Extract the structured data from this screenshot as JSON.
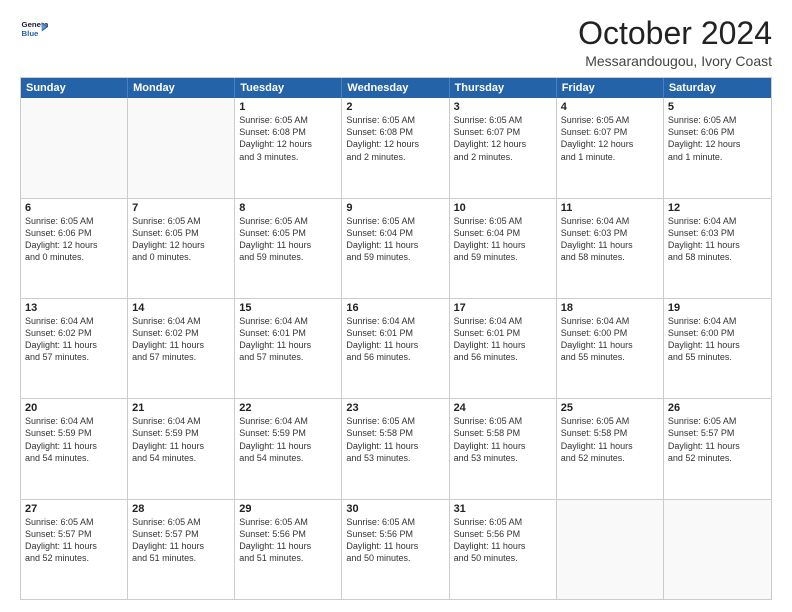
{
  "logo": {
    "line1": "General",
    "line2": "Blue"
  },
  "title": "October 2024",
  "location": "Messarandougou, Ivory Coast",
  "header": {
    "days": [
      "Sunday",
      "Monday",
      "Tuesday",
      "Wednesday",
      "Thursday",
      "Friday",
      "Saturday"
    ]
  },
  "rows": [
    [
      {
        "day": "",
        "empty": true,
        "lines": []
      },
      {
        "day": "",
        "empty": true,
        "lines": []
      },
      {
        "day": "1",
        "empty": false,
        "lines": [
          "Sunrise: 6:05 AM",
          "Sunset: 6:08 PM",
          "Daylight: 12 hours",
          "and 3 minutes."
        ]
      },
      {
        "day": "2",
        "empty": false,
        "lines": [
          "Sunrise: 6:05 AM",
          "Sunset: 6:08 PM",
          "Daylight: 12 hours",
          "and 2 minutes."
        ]
      },
      {
        "day": "3",
        "empty": false,
        "lines": [
          "Sunrise: 6:05 AM",
          "Sunset: 6:07 PM",
          "Daylight: 12 hours",
          "and 2 minutes."
        ]
      },
      {
        "day": "4",
        "empty": false,
        "lines": [
          "Sunrise: 6:05 AM",
          "Sunset: 6:07 PM",
          "Daylight: 12 hours",
          "and 1 minute."
        ]
      },
      {
        "day": "5",
        "empty": false,
        "lines": [
          "Sunrise: 6:05 AM",
          "Sunset: 6:06 PM",
          "Daylight: 12 hours",
          "and 1 minute."
        ]
      }
    ],
    [
      {
        "day": "6",
        "empty": false,
        "lines": [
          "Sunrise: 6:05 AM",
          "Sunset: 6:06 PM",
          "Daylight: 12 hours",
          "and 0 minutes."
        ]
      },
      {
        "day": "7",
        "empty": false,
        "lines": [
          "Sunrise: 6:05 AM",
          "Sunset: 6:05 PM",
          "Daylight: 12 hours",
          "and 0 minutes."
        ]
      },
      {
        "day": "8",
        "empty": false,
        "lines": [
          "Sunrise: 6:05 AM",
          "Sunset: 6:05 PM",
          "Daylight: 11 hours",
          "and 59 minutes."
        ]
      },
      {
        "day": "9",
        "empty": false,
        "lines": [
          "Sunrise: 6:05 AM",
          "Sunset: 6:04 PM",
          "Daylight: 11 hours",
          "and 59 minutes."
        ]
      },
      {
        "day": "10",
        "empty": false,
        "lines": [
          "Sunrise: 6:05 AM",
          "Sunset: 6:04 PM",
          "Daylight: 11 hours",
          "and 59 minutes."
        ]
      },
      {
        "day": "11",
        "empty": false,
        "lines": [
          "Sunrise: 6:04 AM",
          "Sunset: 6:03 PM",
          "Daylight: 11 hours",
          "and 58 minutes."
        ]
      },
      {
        "day": "12",
        "empty": false,
        "lines": [
          "Sunrise: 6:04 AM",
          "Sunset: 6:03 PM",
          "Daylight: 11 hours",
          "and 58 minutes."
        ]
      }
    ],
    [
      {
        "day": "13",
        "empty": false,
        "lines": [
          "Sunrise: 6:04 AM",
          "Sunset: 6:02 PM",
          "Daylight: 11 hours",
          "and 57 minutes."
        ]
      },
      {
        "day": "14",
        "empty": false,
        "lines": [
          "Sunrise: 6:04 AM",
          "Sunset: 6:02 PM",
          "Daylight: 11 hours",
          "and 57 minutes."
        ]
      },
      {
        "day": "15",
        "empty": false,
        "lines": [
          "Sunrise: 6:04 AM",
          "Sunset: 6:01 PM",
          "Daylight: 11 hours",
          "and 57 minutes."
        ]
      },
      {
        "day": "16",
        "empty": false,
        "lines": [
          "Sunrise: 6:04 AM",
          "Sunset: 6:01 PM",
          "Daylight: 11 hours",
          "and 56 minutes."
        ]
      },
      {
        "day": "17",
        "empty": false,
        "lines": [
          "Sunrise: 6:04 AM",
          "Sunset: 6:01 PM",
          "Daylight: 11 hours",
          "and 56 minutes."
        ]
      },
      {
        "day": "18",
        "empty": false,
        "lines": [
          "Sunrise: 6:04 AM",
          "Sunset: 6:00 PM",
          "Daylight: 11 hours",
          "and 55 minutes."
        ]
      },
      {
        "day": "19",
        "empty": false,
        "lines": [
          "Sunrise: 6:04 AM",
          "Sunset: 6:00 PM",
          "Daylight: 11 hours",
          "and 55 minutes."
        ]
      }
    ],
    [
      {
        "day": "20",
        "empty": false,
        "lines": [
          "Sunrise: 6:04 AM",
          "Sunset: 5:59 PM",
          "Daylight: 11 hours",
          "and 54 minutes."
        ]
      },
      {
        "day": "21",
        "empty": false,
        "lines": [
          "Sunrise: 6:04 AM",
          "Sunset: 5:59 PM",
          "Daylight: 11 hours",
          "and 54 minutes."
        ]
      },
      {
        "day": "22",
        "empty": false,
        "lines": [
          "Sunrise: 6:04 AM",
          "Sunset: 5:59 PM",
          "Daylight: 11 hours",
          "and 54 minutes."
        ]
      },
      {
        "day": "23",
        "empty": false,
        "lines": [
          "Sunrise: 6:05 AM",
          "Sunset: 5:58 PM",
          "Daylight: 11 hours",
          "and 53 minutes."
        ]
      },
      {
        "day": "24",
        "empty": false,
        "lines": [
          "Sunrise: 6:05 AM",
          "Sunset: 5:58 PM",
          "Daylight: 11 hours",
          "and 53 minutes."
        ]
      },
      {
        "day": "25",
        "empty": false,
        "lines": [
          "Sunrise: 6:05 AM",
          "Sunset: 5:58 PM",
          "Daylight: 11 hours",
          "and 52 minutes."
        ]
      },
      {
        "day": "26",
        "empty": false,
        "lines": [
          "Sunrise: 6:05 AM",
          "Sunset: 5:57 PM",
          "Daylight: 11 hours",
          "and 52 minutes."
        ]
      }
    ],
    [
      {
        "day": "27",
        "empty": false,
        "lines": [
          "Sunrise: 6:05 AM",
          "Sunset: 5:57 PM",
          "Daylight: 11 hours",
          "and 52 minutes."
        ]
      },
      {
        "day": "28",
        "empty": false,
        "lines": [
          "Sunrise: 6:05 AM",
          "Sunset: 5:57 PM",
          "Daylight: 11 hours",
          "and 51 minutes."
        ]
      },
      {
        "day": "29",
        "empty": false,
        "lines": [
          "Sunrise: 6:05 AM",
          "Sunset: 5:56 PM",
          "Daylight: 11 hours",
          "and 51 minutes."
        ]
      },
      {
        "day": "30",
        "empty": false,
        "lines": [
          "Sunrise: 6:05 AM",
          "Sunset: 5:56 PM",
          "Daylight: 11 hours",
          "and 50 minutes."
        ]
      },
      {
        "day": "31",
        "empty": false,
        "lines": [
          "Sunrise: 6:05 AM",
          "Sunset: 5:56 PM",
          "Daylight: 11 hours",
          "and 50 minutes."
        ]
      },
      {
        "day": "",
        "empty": true,
        "lines": []
      },
      {
        "day": "",
        "empty": true,
        "lines": []
      }
    ]
  ]
}
